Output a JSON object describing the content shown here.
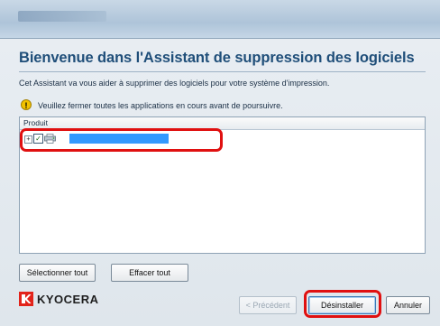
{
  "window": {
    "heading": "Bienvenue dans l'Assistant de suppression des logiciels",
    "description": "Cet Assistant va vous aider à supprimer des logiciels pour votre système d'impression.",
    "warning": "Veuillez fermer toutes les applications en cours avant de poursuivre."
  },
  "product_list": {
    "column_header": "Produit",
    "items": [
      {
        "checked": true,
        "icon": "printer-icon",
        "selected": true
      }
    ]
  },
  "buttons": {
    "select_all": "Sélectionner tout",
    "clear_all": "Effacer tout",
    "previous": "< Précédent",
    "uninstall": "Désinstaller",
    "cancel": "Annuler"
  },
  "brand": {
    "logo_text": "KYOCERA",
    "logo_color": "#e2231a"
  },
  "colors": {
    "heading": "#1f4e79",
    "highlight": "#e01010",
    "selection": "#3399ff"
  }
}
